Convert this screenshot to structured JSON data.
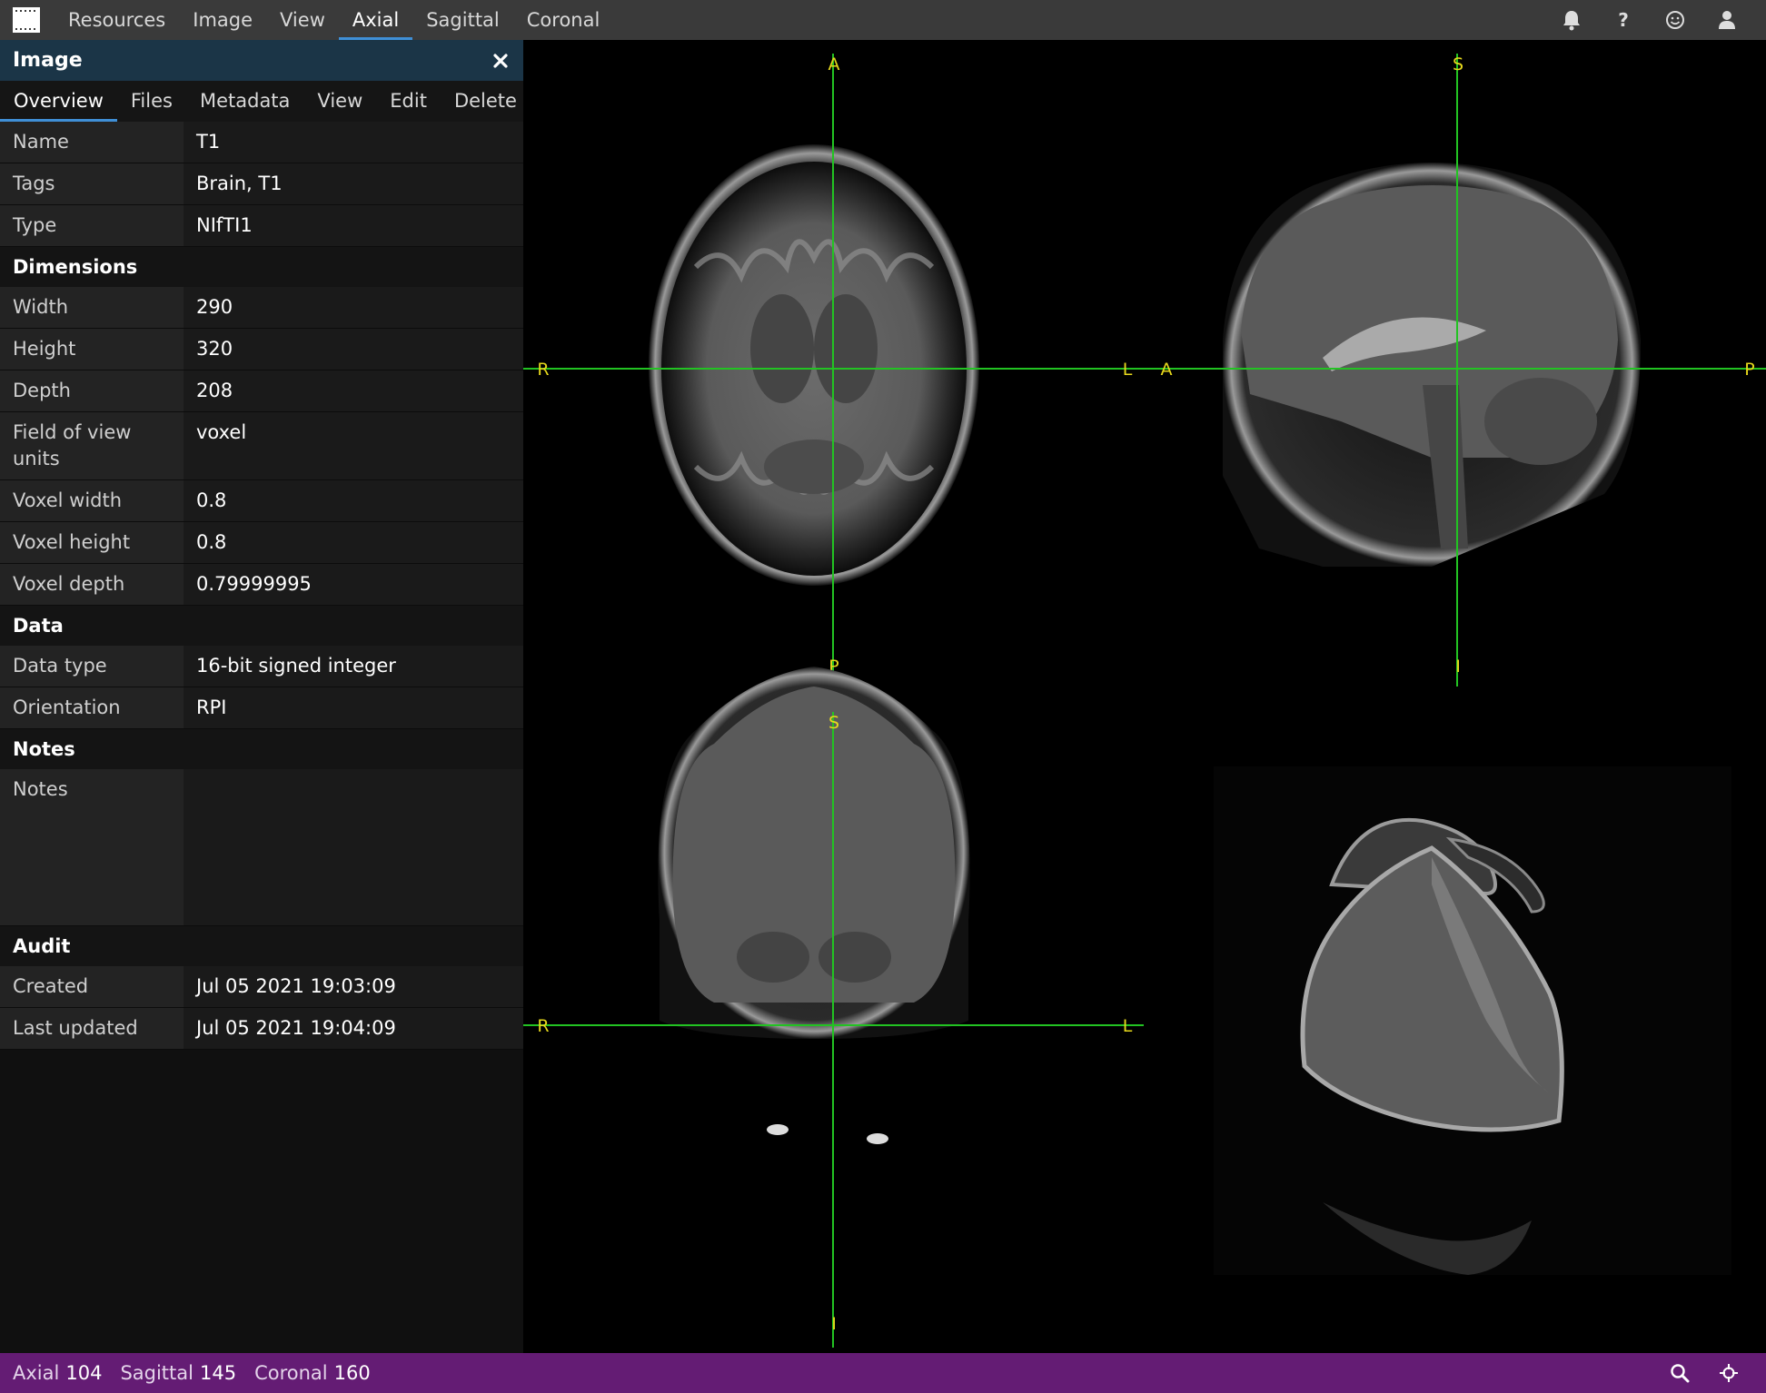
{
  "menu": {
    "items": [
      "Resources",
      "Image",
      "View",
      "Axial",
      "Sagittal",
      "Coronal"
    ],
    "active": "Axial"
  },
  "top_icons": [
    "bell-icon",
    "help-icon",
    "smiley-icon",
    "user-icon"
  ],
  "panel": {
    "title": "Image",
    "tabs": [
      "Overview",
      "Files",
      "Metadata",
      "View",
      "Edit",
      "Delete"
    ],
    "active_tab": "Overview",
    "general": [
      {
        "label": "Name",
        "value": "T1"
      },
      {
        "label": "Tags",
        "value": "Brain, T1"
      },
      {
        "label": "Type",
        "value": "NIfTI1"
      }
    ],
    "dimensions": {
      "title": "Dimensions",
      "rows": [
        {
          "label": "Width",
          "value": "290"
        },
        {
          "label": "Height",
          "value": "320"
        },
        {
          "label": "Depth",
          "value": "208"
        },
        {
          "label": "Field of view units",
          "value": "voxel"
        },
        {
          "label": "Voxel width",
          "value": "0.8"
        },
        {
          "label": "Voxel height",
          "value": "0.8"
        },
        {
          "label": "Voxel depth",
          "value": "0.79999995"
        }
      ]
    },
    "data": {
      "title": "Data",
      "rows": [
        {
          "label": "Data type",
          "value": "16-bit signed integer"
        },
        {
          "label": "Orientation",
          "value": "RPI"
        }
      ]
    },
    "notes": {
      "title": "Notes",
      "label": "Notes",
      "value": ""
    },
    "audit": {
      "title": "Audit",
      "rows": [
        {
          "label": "Created",
          "value": "Jul 05 2021 19:03:09"
        },
        {
          "label": "Last updated",
          "value": "Jul 05 2021 19:04:09"
        }
      ]
    }
  },
  "viewer": {
    "axial": {
      "top": "A",
      "bottom": "P",
      "left": "R",
      "right": "L"
    },
    "sagittal": {
      "top": "S",
      "bottom": "I",
      "left": "A",
      "right": "P"
    },
    "coronal": {
      "top": "S",
      "bottom": "I",
      "left": "R",
      "right": "L"
    },
    "crosshair_color": "#22c322",
    "label_color": "#e7d91c"
  },
  "status": {
    "axial_label": "Axial",
    "axial_value": "104",
    "sagittal_label": "Sagittal",
    "sagittal_value": "145",
    "coronal_label": "Coronal",
    "coronal_value": "160",
    "icons": [
      "search-icon",
      "crosshair-icon"
    ],
    "bg_color": "#641c74"
  }
}
